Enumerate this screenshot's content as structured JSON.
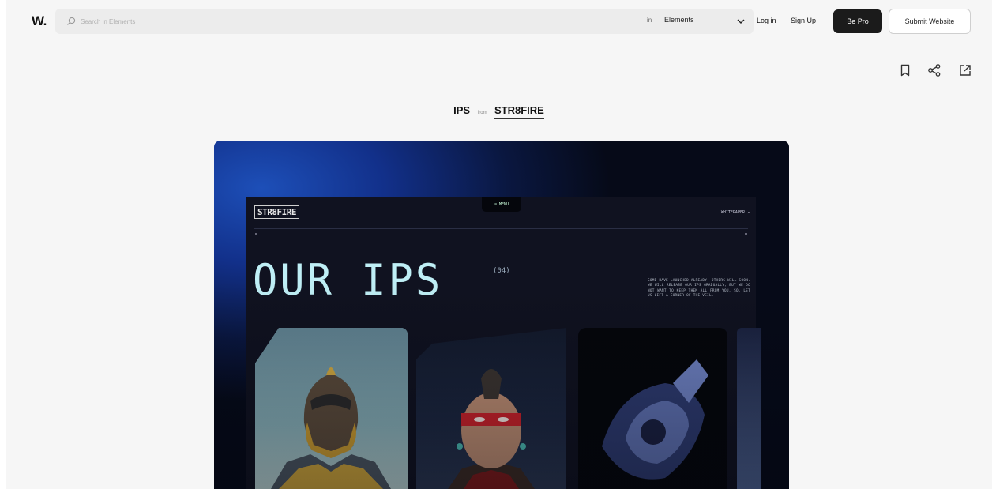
{
  "header": {
    "logo": "W.",
    "search_placeholder": "Search in Elements",
    "search_in": "in",
    "search_scope": "Elements",
    "login": "Log in",
    "signup": "Sign Up",
    "be_pro": "Be Pro",
    "submit": "Submit Website"
  },
  "toolbar": {
    "icons": [
      "bookmark-icon",
      "share-icon",
      "external-link-icon"
    ]
  },
  "title": {
    "name": "IPS",
    "from": "from",
    "site": "STR8FIRE"
  },
  "preview": {
    "logo": "STR8FIRE",
    "menu": "≡ MENU",
    "whitepaper": "WHITEPAPER ↗",
    "heading": "OUR IPS",
    "count": "(04)",
    "description": "SOME HAVE LAUNCHED ALREADY, OTHERS WILL SOON. WE WILL RELEASE OUR IPS GRADUALLY, BUT WE DO NOT WANT TO KEEP THEM ALL FROM YOU. SO, LET US LIFT A CORNER OF THE VEIL."
  },
  "colors": {
    "pro_button": "#1b1b1b",
    "heading": "#bfeff6",
    "site_bg": "#101220"
  }
}
